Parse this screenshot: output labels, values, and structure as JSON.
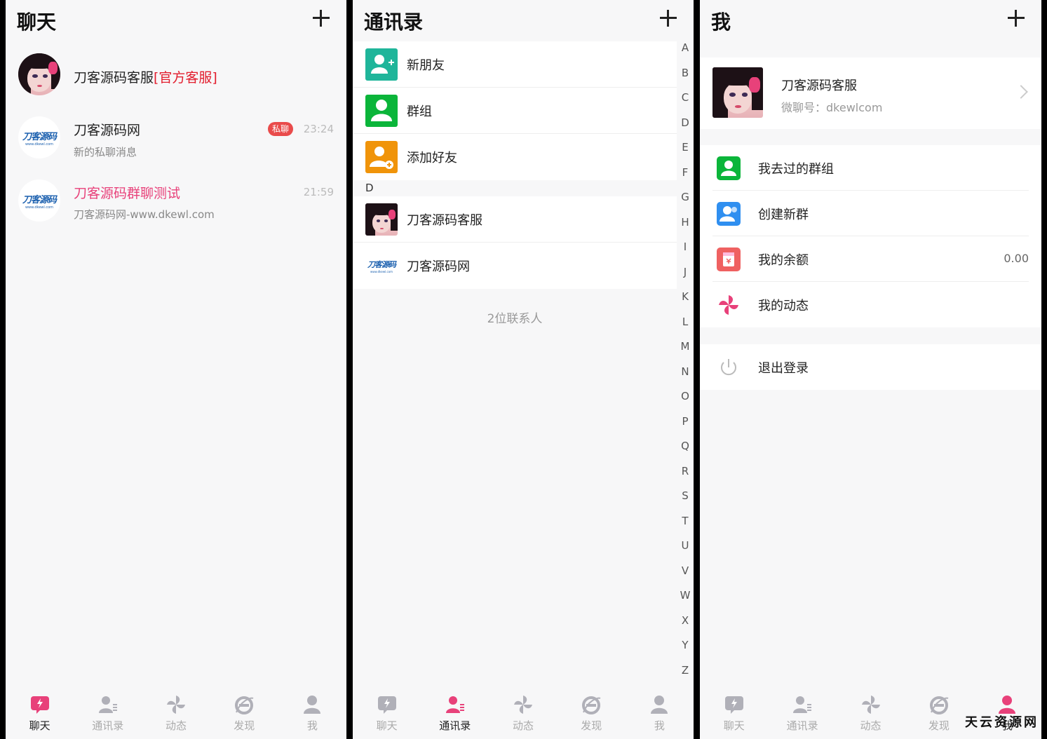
{
  "colors": {
    "accent": "#e8417a",
    "green": "#0bb53a",
    "teal": "#1fb59a",
    "orange": "#f0940a",
    "blue": "#2f8ff0",
    "red": "#ef6161",
    "inactive": "#b0b0b8"
  },
  "chat": {
    "title": "聊天",
    "items": [
      {
        "name": "刀客源码客服",
        "tag": "[官方客服]",
        "avatar": "girl"
      },
      {
        "name": "刀客源码网",
        "badge": "私聊",
        "time": "23:24",
        "sub": "新的私聊消息",
        "avatar": "logo"
      },
      {
        "name": "刀客源码群聊测试",
        "time": "21:59",
        "sub": "刀客源码网-www.dkewl.com",
        "avatar": "logo"
      }
    ]
  },
  "contacts": {
    "title": "通讯录",
    "fixed": [
      {
        "label": "新朋友",
        "icon": "add-friend-icon"
      },
      {
        "label": "群组",
        "icon": "group-icon"
      },
      {
        "label": "添加好友",
        "icon": "add-contact-icon"
      }
    ],
    "section": "D",
    "people": [
      {
        "label": "刀客源码客服",
        "avatar": "girl"
      },
      {
        "label": "刀客源码网",
        "avatar": "logo"
      }
    ],
    "count": "2位联系人",
    "index": [
      "A",
      "B",
      "C",
      "D",
      "E",
      "F",
      "G",
      "H",
      "I",
      "J",
      "K",
      "L",
      "M",
      "N",
      "O",
      "P",
      "Q",
      "R",
      "S",
      "T",
      "U",
      "V",
      "W",
      "X",
      "Y",
      "Z"
    ]
  },
  "me": {
    "title": "我",
    "name": "刀客源码客服",
    "id": "微聊号：dkewlcom",
    "rows": [
      {
        "label": "我去过的群组",
        "icon": "group-history-icon"
      },
      {
        "label": "创建新群",
        "icon": "create-group-icon"
      },
      {
        "label": "我的余额",
        "icon": "wallet-icon",
        "value": "0.00"
      },
      {
        "label": "我的动态",
        "icon": "pinwheel-icon"
      }
    ],
    "logout": "退出登录"
  },
  "logo": {
    "text": "刀客源码",
    "sub": "www.dkewl.com"
  },
  "tabs": [
    "聊天",
    "通讯录",
    "动态",
    "发现",
    "我"
  ],
  "watermark": "天云资源网"
}
